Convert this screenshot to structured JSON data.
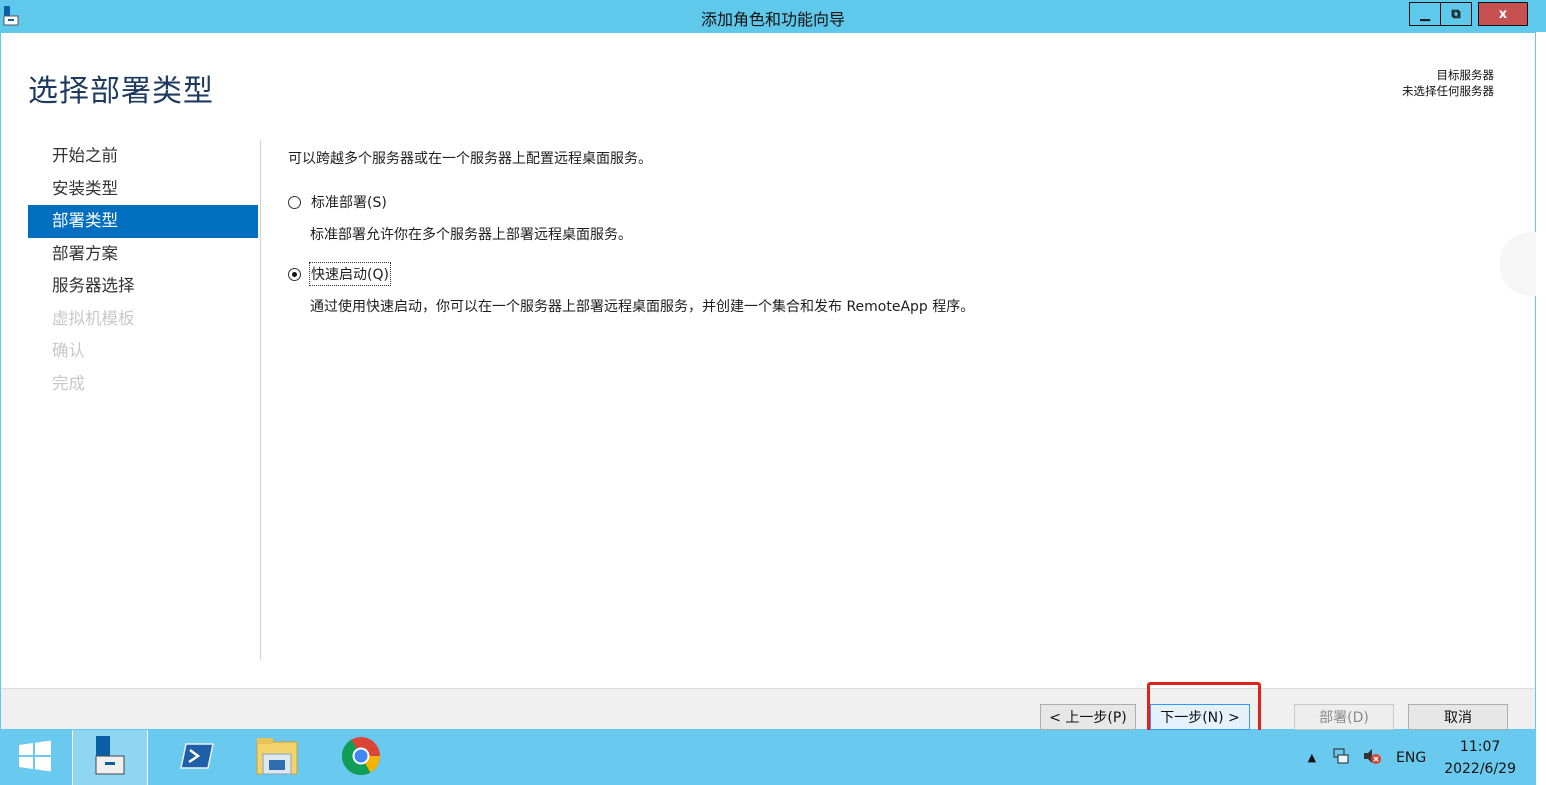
{
  "window": {
    "title": "添加角色和功能向导",
    "controls": {
      "minimize": "–",
      "maximize": "□",
      "close": "x"
    }
  },
  "header": {
    "page_title": "选择部署类型",
    "dest_label": "目标服务器",
    "dest_value": "未选择任何服务器"
  },
  "nav": {
    "items": [
      {
        "label": "开始之前",
        "state": "normal"
      },
      {
        "label": "安装类型",
        "state": "normal"
      },
      {
        "label": "部署类型",
        "state": "active"
      },
      {
        "label": "部署方案",
        "state": "normal"
      },
      {
        "label": "服务器选择",
        "state": "normal"
      },
      {
        "label": "虚拟机模板",
        "state": "disabled"
      },
      {
        "label": "确认",
        "state": "disabled"
      },
      {
        "label": "完成",
        "state": "disabled"
      }
    ]
  },
  "content": {
    "intro": "可以跨越多个服务器或在一个服务器上配置远程桌面服务。",
    "options": [
      {
        "label": "标准部署(S)",
        "checked": false,
        "description": "标准部署允许你在多个服务器上部署远程桌面服务。"
      },
      {
        "label": "快速启动(Q)",
        "checked": true,
        "description": "通过使用快速启动，你可以在一个服务器上部署远程桌面服务，并创建一个集合和发布 RemoteApp 程序。"
      }
    ]
  },
  "footer": {
    "prev": "< 上一步(P)",
    "next": "下一步(N) >",
    "deploy": "部署(D)",
    "cancel": "取消"
  },
  "taskbar": {
    "tray_language": "ENG",
    "time": "11:07",
    "date": "2022/6/29",
    "icons": [
      "start-icon",
      "server-manager-icon",
      "powershell-icon",
      "file-explorer-icon",
      "chrome-icon"
    ]
  },
  "colors": {
    "titlebar": "#5fc9ec",
    "active_nav": "#006fc0",
    "taskbar": "#6ac9ef",
    "highlight": "#e0241c"
  }
}
